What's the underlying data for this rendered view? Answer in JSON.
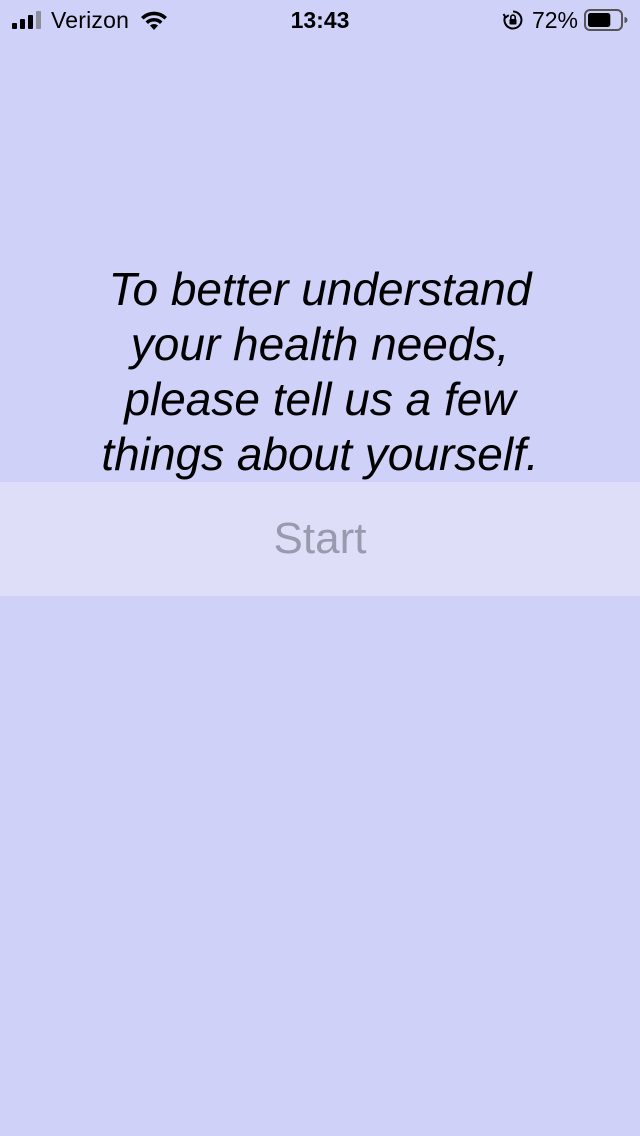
{
  "status_bar": {
    "carrier": "Verizon",
    "time": "13:43",
    "battery_percent": "72%",
    "signal_icon": "cellular-signal-icon",
    "wifi_icon": "wifi-icon",
    "lock_icon": "orientation-lock-icon",
    "battery_icon": "battery-icon",
    "battery_level": 0.72
  },
  "main": {
    "intro_text": "To better understand your health needs, please tell us a few things about yourself.",
    "start_label": "Start"
  },
  "colors": {
    "background": "#d0d1f8",
    "button_background": "#dedef9",
    "button_text": "#9a9aaf",
    "text": "#000000"
  }
}
